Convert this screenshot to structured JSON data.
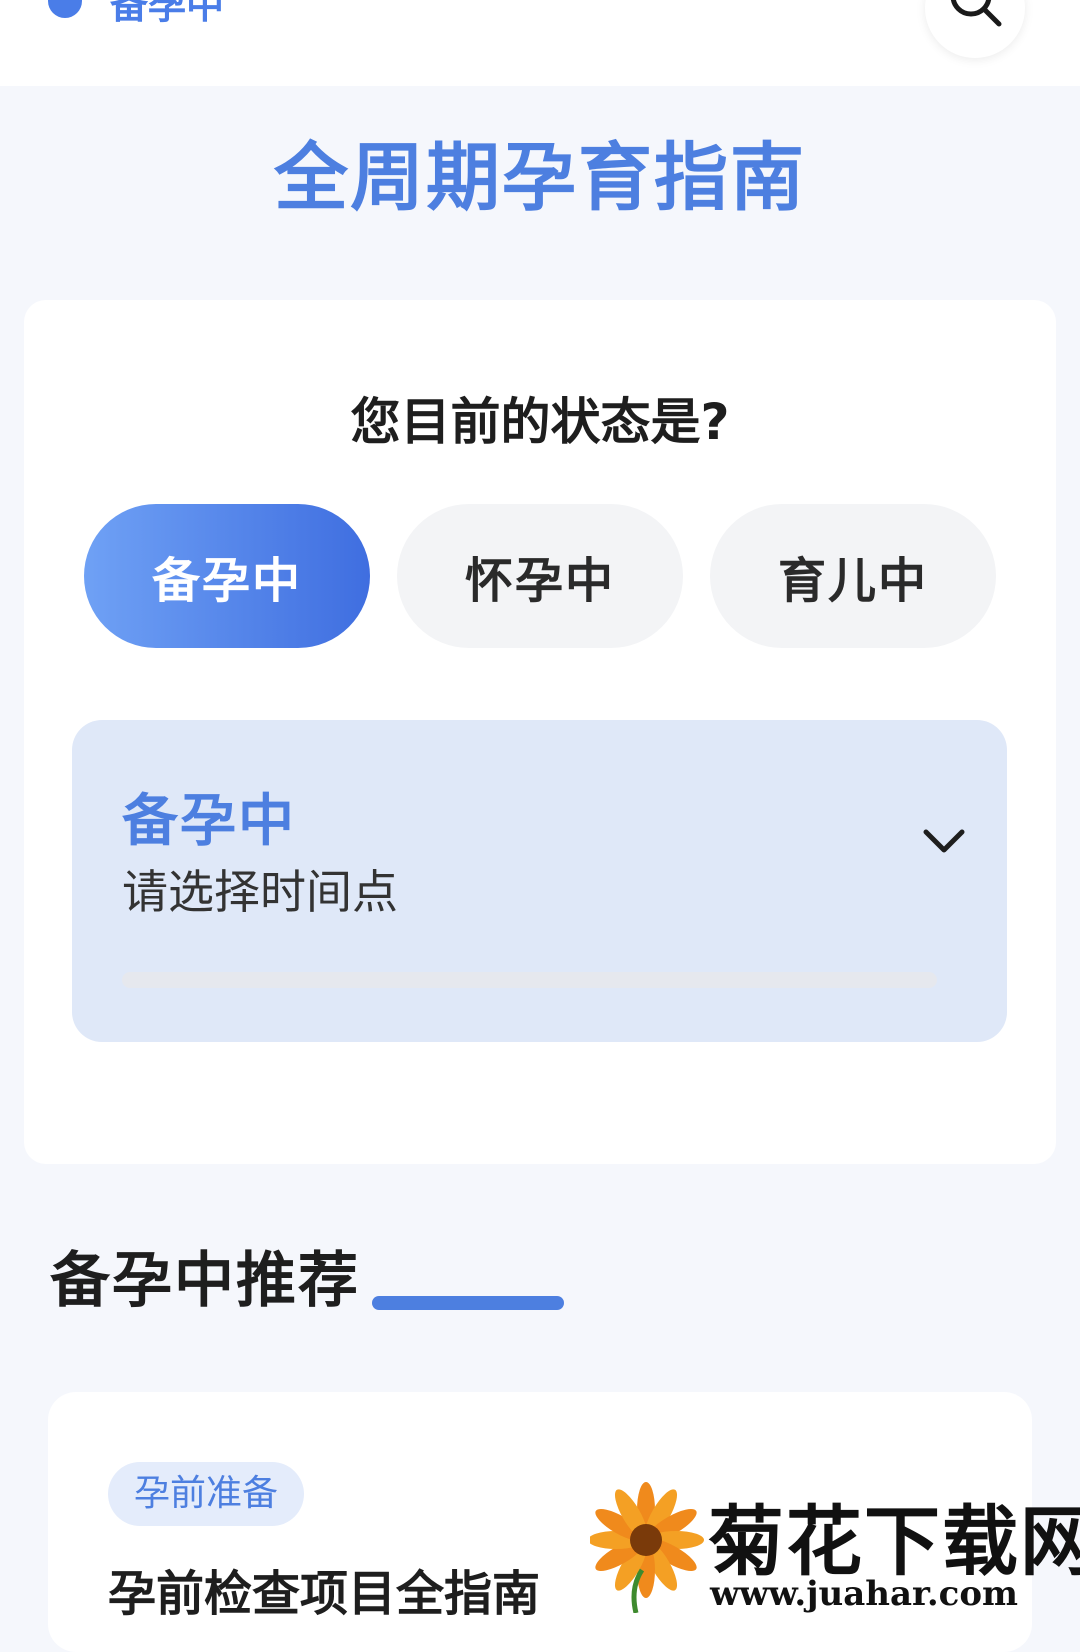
{
  "topbar": {
    "status_label": "备孕中",
    "search_icon": "search-icon"
  },
  "page_title": "全周期孕育指南",
  "status_card": {
    "question": "您目前的状态是?",
    "options": [
      {
        "label": "备孕中",
        "selected": true
      },
      {
        "label": "怀孕中",
        "selected": false
      },
      {
        "label": "育儿中",
        "selected": false
      }
    ],
    "panel": {
      "stage": "备孕中",
      "hint": "请选择时间点",
      "chevron_icon": "chevron-down-icon"
    }
  },
  "recommend": {
    "section_title": "备孕中推荐",
    "items": [
      {
        "tag": "孕前准备",
        "title": "孕前检查项目全指南"
      }
    ]
  },
  "watermark": {
    "name": "菊花下载网",
    "url": "www.juahar.com"
  },
  "colors": {
    "accent": "#4d7fe0",
    "accent_gradient_start": "#6fa1f5",
    "accent_gradient_end": "#3f6ee0",
    "panel_bg": "#dfe8f8",
    "page_bg": "#f5f7fc"
  }
}
